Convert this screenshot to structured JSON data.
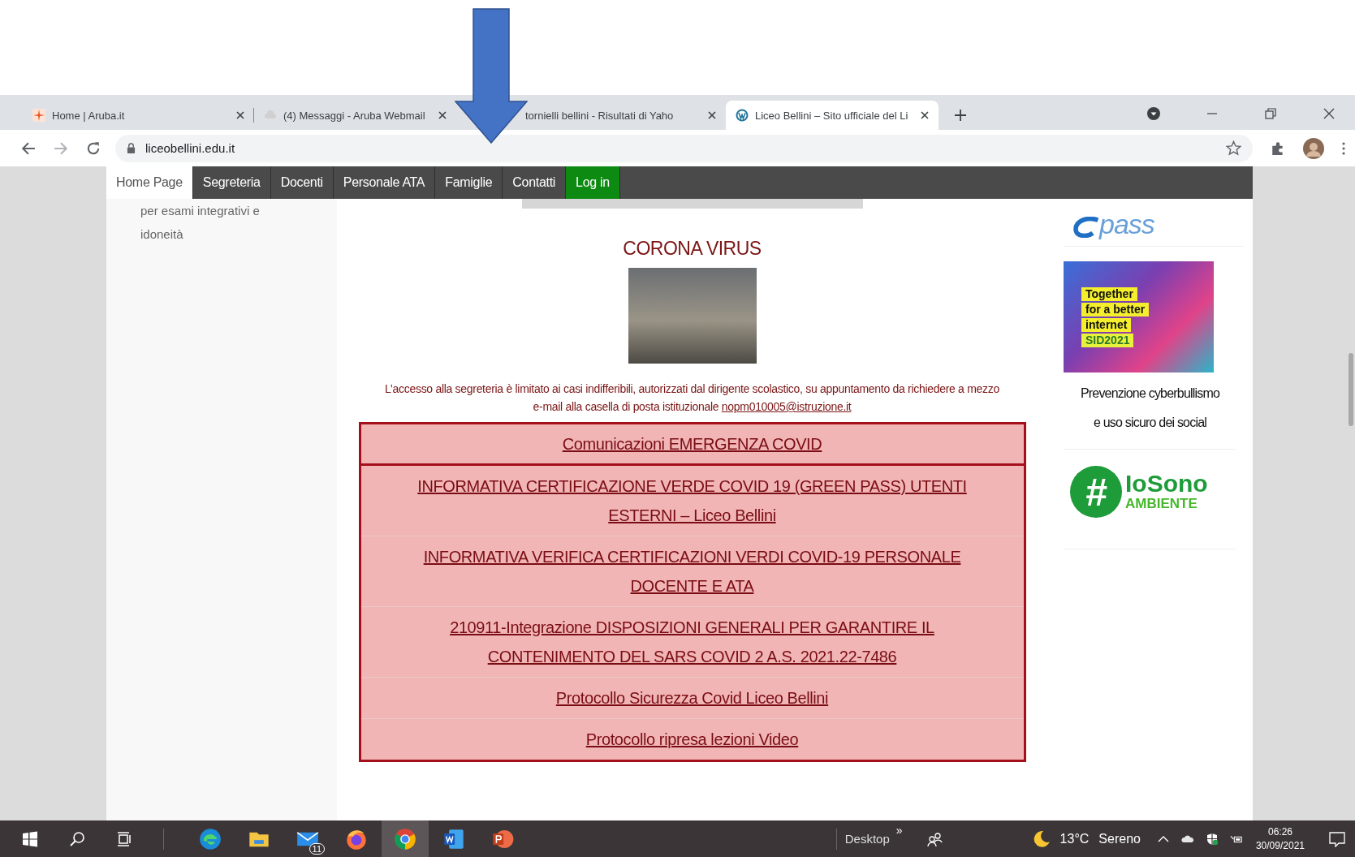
{
  "browser": {
    "tabs": [
      {
        "title": "Home | Aruba.it",
        "kind": "aruba",
        "selected": false
      },
      {
        "title": "(4) Messaggi - Aruba Webmail",
        "kind": "webmail",
        "selected": false
      },
      {
        "title": "tornielli bellini - Risultati di Yaho",
        "selected": false
      },
      {
        "title": "Liceo Bellini – Sito ufficiale del Li",
        "kind": "wordpress",
        "selected": true
      }
    ],
    "address": "liceobellini.edu.it"
  },
  "site_nav": [
    {
      "label": "Home Page",
      "kind": "page",
      "selected": true
    },
    {
      "label": "Segreteria",
      "kind": "page",
      "selected": false
    },
    {
      "label": "Docenti",
      "kind": "page",
      "selected": false
    },
    {
      "label": "Personale ATA",
      "kind": "page",
      "selected": false
    },
    {
      "label": "Famiglie",
      "kind": "page",
      "selected": false
    },
    {
      "label": "Contatti",
      "kind": "page",
      "selected": false
    },
    {
      "label": "Log in",
      "kind": "login",
      "selected": false
    }
  ],
  "left_sidebar": {
    "lines": [
      "per esami integrativi e",
      "idoneità"
    ]
  },
  "main": {
    "heading": "CORONA VIRUS",
    "notice": "L’accesso alla segreteria è limitato ai casi indifferibili, autorizzati dal dirigente scolastico, su appuntamento da richiedere a mezzo e-mail alla casella di posta istituzionale",
    "notice_link": "nopm010005@istruzione.it",
    "links": [
      "Comunicazioni EMERGENZA COVID",
      "INFORMATIVA CERTIFICAZIONE VERDE COVID 19 (GREEN PASS) UTENTI ESTERNI – Liceo Bellini",
      "INFORMATIVA VERIFICA CERTIFICAZIONI VERDI COVID-19 PERSONALE DOCENTE E ATA",
      "210911-Integrazione DISPOSIZIONI GENERALI PER GARANTIRE IL CONTENIMENTO DEL SARS COVID 2 A.S. 2021.22-7486",
      "Protocollo Sicurezza Covid Liceo Bellini",
      "Protocollo ripresa lezioni Video"
    ]
  },
  "right_sidebar": {
    "epass_logo": "pass",
    "banner_lines": [
      "Together",
      "for a better",
      "internet",
      "SID2021"
    ],
    "caption_lines": [
      "Prevenzione cyberbullismo",
      "e uso sicuro dei social"
    ],
    "iosono_logo": {
      "mark": "#",
      "top": "IoSono",
      "bottom": "AMBIENTE"
    }
  },
  "taskbar": {
    "apps": [
      {
        "kind": "edge",
        "selected": false
      },
      {
        "kind": "explorer",
        "selected": false
      },
      {
        "kind": "mail",
        "selected": false,
        "badge": "11"
      },
      {
        "kind": "firefox",
        "selected": false
      },
      {
        "kind": "chrome",
        "selected": true
      },
      {
        "kind": "word",
        "selected": false
      },
      {
        "kind": "powerpoint",
        "selected": false
      }
    ],
    "desktop_label": "Desktop",
    "desktop_chevron": "»",
    "temperature": "13°C",
    "weather": "Sereno",
    "time": "06:26",
    "date": "30/09/2021"
  }
}
